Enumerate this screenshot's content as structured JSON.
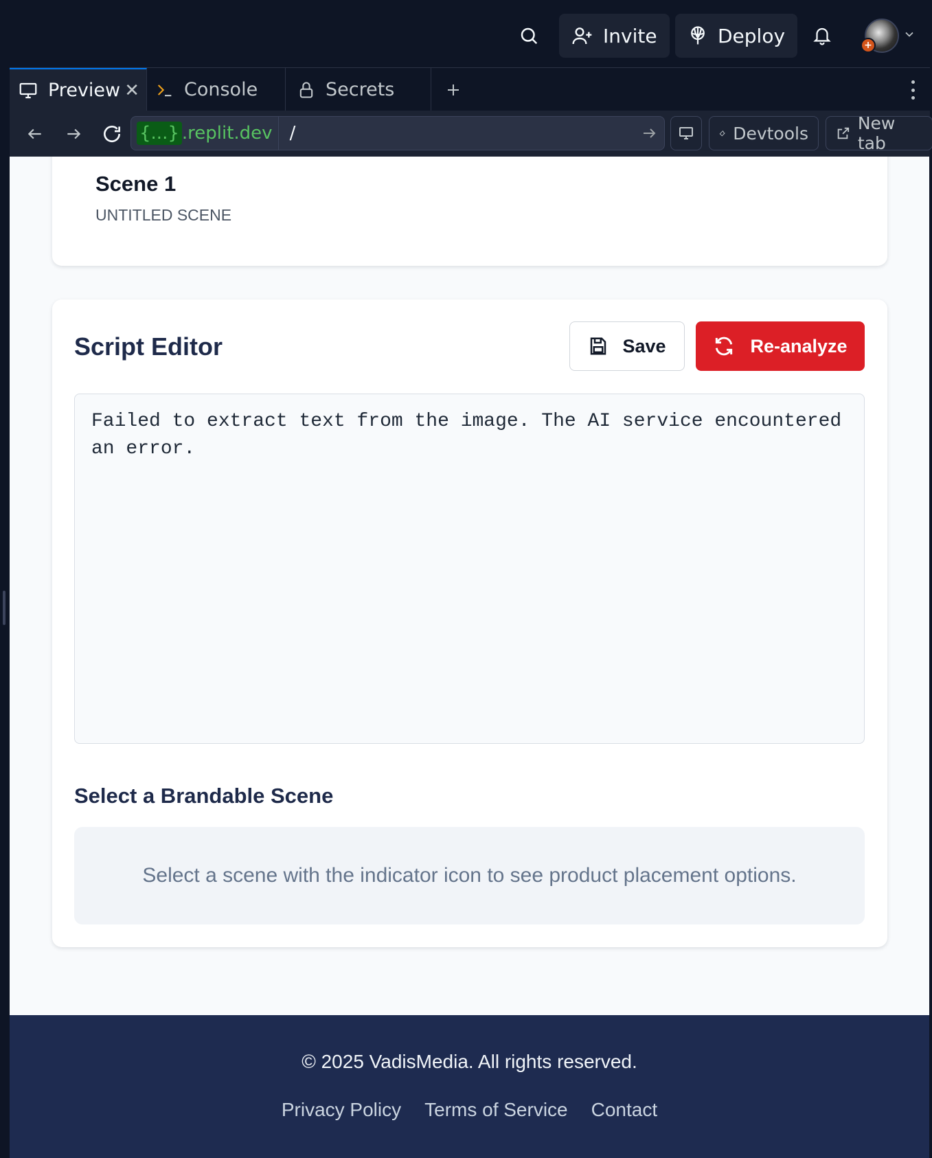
{
  "topbar": {
    "invite_label": "Invite",
    "deploy_label": "Deploy"
  },
  "tabs": [
    {
      "label": "Preview",
      "icon": "monitor-icon",
      "active": true
    },
    {
      "label": "Console",
      "icon": "terminal-icon",
      "active": false
    },
    {
      "label": "Secrets",
      "icon": "lock-icon",
      "active": false
    }
  ],
  "urlbar": {
    "host_braces": "{...}",
    "host_domain": ".replit.dev",
    "path": "/",
    "devtools_label": "Devtools",
    "new_tab_label": "New tab"
  },
  "scene": {
    "title": "Scene 1",
    "subtitle": "UNTITLED SCENE"
  },
  "editor": {
    "title": "Script Editor",
    "save_label": "Save",
    "reanalyze_label": "Re-analyze",
    "script_text": "Failed to extract text from the image. The AI service encountered an error."
  },
  "brandable": {
    "title": "Select a Brandable Scene",
    "hint": "Select a scene with the indicator icon to see product placement options."
  },
  "footer": {
    "copyright": "© 2025 VadisMedia. All rights reserved.",
    "links": [
      "Privacy Policy",
      "Terms of Service",
      "Contact"
    ]
  },
  "colors": {
    "ide_background": "#0e1525",
    "accent_red": "#dc1f26",
    "footer_navy": "#1e2b50",
    "heading_navy": "#1e2a4a",
    "url_green": "#58c461"
  }
}
